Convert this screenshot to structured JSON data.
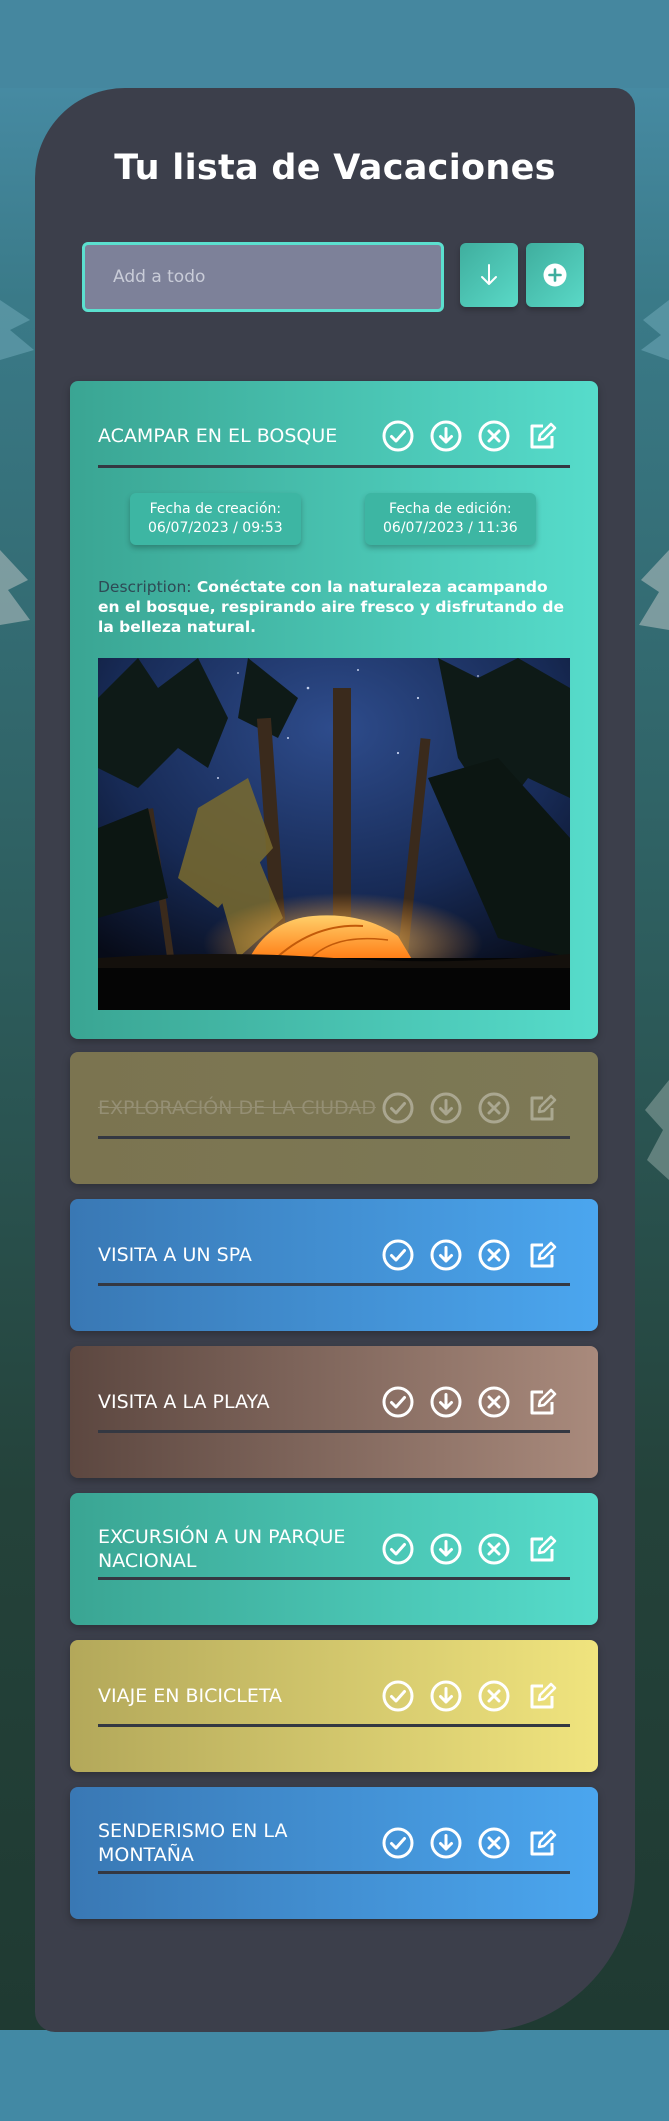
{
  "title": "Tu lista de Vacaciones",
  "add": {
    "placeholder": "Add a todo",
    "sort_icon": "arrow-down-icon",
    "add_icon": "plus-circle-icon"
  },
  "labels": {
    "created": "Fecha de creación:",
    "edited": "Fecha de edición:",
    "description": "Description:"
  },
  "todos": [
    {
      "title": "ACAMPAR EN EL BOSQUE",
      "color": "#4cc9b6",
      "expanded": true,
      "created": "06/07/2023 / 09:53",
      "edited": "06/07/2023 / 11:36",
      "description": "Conéctate con la naturaleza acampando en el bosque, respirando aire fresco y disfrutando de la belleza natural.",
      "image": "night-forest-tent-photo"
    },
    {
      "title": "EXPLORACIÓN DE LA CIUDAD",
      "color": "#7b7652",
      "completed": true
    },
    {
      "title": "VISITA A UN SPA",
      "color": "#4391d6"
    },
    {
      "title": "VISITA A LA PLAYA",
      "color": "#8a6f64"
    },
    {
      "title": "EXCURSIÓN A UN PARQUE NACIONAL",
      "color": "#4cc9b6"
    },
    {
      "title": "VIAJE EN BICICLETA",
      "color": "#d3c86c"
    },
    {
      "title": "SENDERISMO EN LA MONTAÑA",
      "color": "#4391d6"
    }
  ],
  "actions": [
    "check-circle-icon",
    "download-circle-icon",
    "x-circle-icon",
    "edit-icon"
  ]
}
